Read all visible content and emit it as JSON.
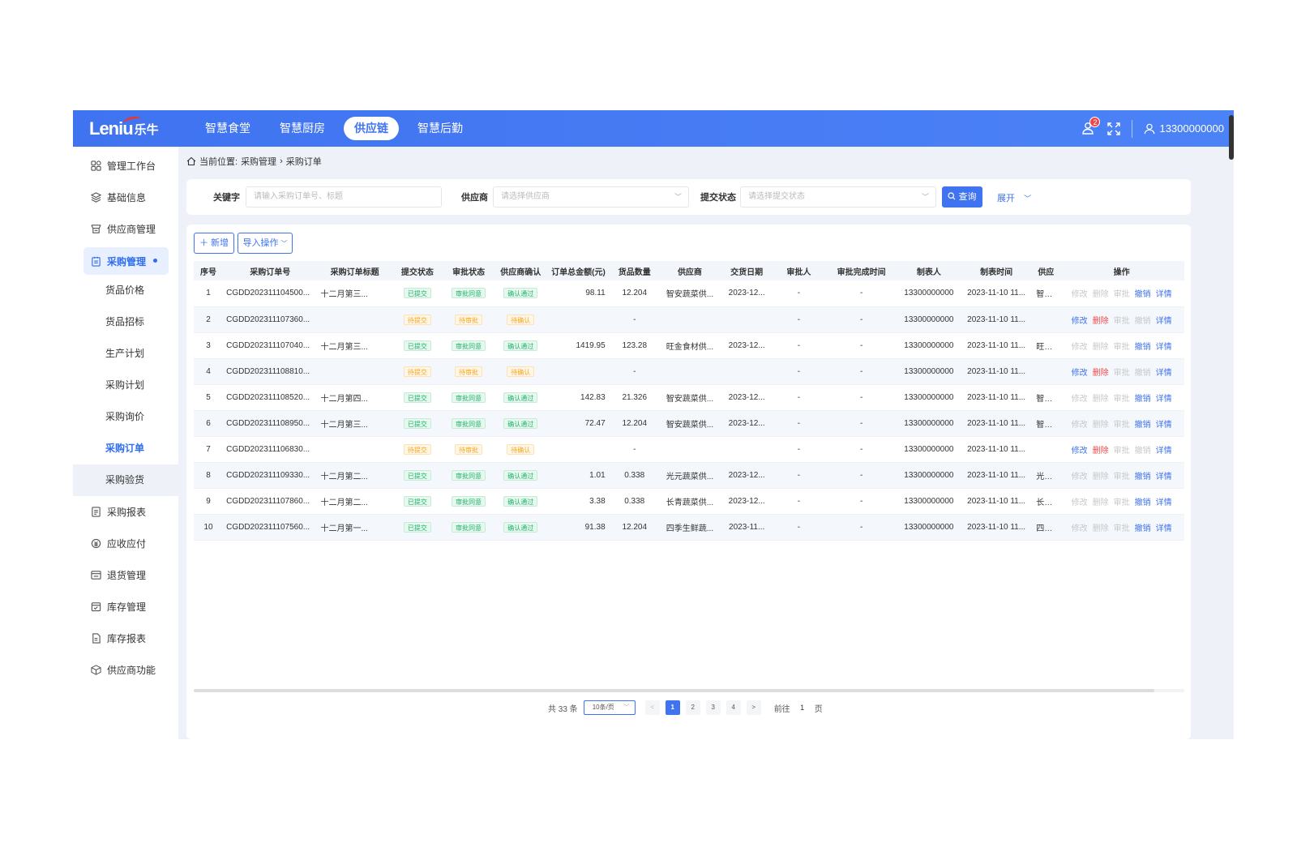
{
  "header": {
    "logo_text": "Leniu",
    "logo_cn": "乐牛",
    "nav": [
      {
        "label": "智慧食堂",
        "active": false
      },
      {
        "label": "智慧厨房",
        "active": false
      },
      {
        "label": "供应链",
        "active": true
      },
      {
        "label": "智慧后勤",
        "active": false
      }
    ],
    "notification_count": "2",
    "user_name": "13300000000"
  },
  "sidebar": {
    "items": [
      {
        "label": "管理工作台",
        "icon": "dashboard-icon"
      },
      {
        "label": "基础信息",
        "icon": "layers-icon"
      },
      {
        "label": "供应商管理",
        "icon": "supplier-icon"
      },
      {
        "label": "采购管理",
        "icon": "purchase-icon"
      },
      {
        "label": "采购报表",
        "icon": "report-icon"
      },
      {
        "label": "应收应付",
        "icon": "payment-icon"
      },
      {
        "label": "退货管理",
        "icon": "return-icon"
      },
      {
        "label": "库存管理",
        "icon": "inventory-icon"
      },
      {
        "label": "库存报表",
        "icon": "inventory-report-icon"
      },
      {
        "label": "供应商功能",
        "icon": "box-icon"
      }
    ],
    "sub_items": [
      "货品价格",
      "货品招标",
      "生产计划",
      "采购计划",
      "采购询价",
      "采购订单",
      "采购验货"
    ]
  },
  "breadcrumb": {
    "prefix": "当前位置:",
    "parent": "采购管理",
    "current": "采购订单"
  },
  "filter": {
    "keyword_label": "关键字",
    "keyword_placeholder": "请输入采购订单号、标题",
    "supplier_label": "供应商",
    "supplier_placeholder": "请选择供应商",
    "status_label": "提交状态",
    "status_placeholder": "请选择提交状态",
    "query_label": "查询",
    "expand_label": "展开"
  },
  "toolbar": {
    "add_label": "新增",
    "import_label": "导入操作"
  },
  "table": {
    "headers": [
      "序号",
      "采购订单号",
      "采购订单标题",
      "提交状态",
      "审批状态",
      "供应商确认",
      "订单总金额(元)",
      "货品数量",
      "供应商",
      "交货日期",
      "审批人",
      "审批完成时间",
      "制表人",
      "制表时间",
      "供应",
      "操作"
    ],
    "rows": [
      {
        "no": "1",
        "order_no": "CGDD202311104500...",
        "title": "十二月第三...",
        "submit": "已提交",
        "approve": "审批同意",
        "confirm": "确认通过",
        "amount": "98.11",
        "qty": "12.204",
        "supplier": "智安蔬菜供...",
        "delivery": "2023-12...",
        "approver": "-",
        "approve_time": "-",
        "maker": "13300000000",
        "make_time": "2023-11-10 11...",
        "supplier2": "智安蔬",
        "ops": [
          "修改",
          "删除",
          "审批",
          "撤销",
          "详情"
        ]
      },
      {
        "no": "2",
        "order_no": "CGDD202311107360...",
        "title": "",
        "submit": "待提交",
        "approve": "待审批",
        "confirm": "待确认",
        "amount": "",
        "qty": "-",
        "supplier": "",
        "delivery": "",
        "approver": "-",
        "approve_time": "-",
        "maker": "13300000000",
        "make_time": "2023-11-10 11...",
        "supplier2": "",
        "ops": [
          "修改",
          "删除",
          "审批",
          "撤销",
          "详情"
        ]
      },
      {
        "no": "3",
        "order_no": "CGDD202311107040...",
        "title": "十二月第三...",
        "submit": "已提交",
        "approve": "审批同意",
        "confirm": "确认通过",
        "amount": "1419.95",
        "qty": "123.28",
        "supplier": "旺金食材供...",
        "delivery": "2023-12...",
        "approver": "-",
        "approve_time": "-",
        "maker": "13300000000",
        "make_time": "2023-11-10 11...",
        "supplier2": "旺金食",
        "ops": [
          "修改",
          "删除",
          "审批",
          "撤销",
          "详情"
        ]
      },
      {
        "no": "4",
        "order_no": "CGDD202311108810...",
        "title": "",
        "submit": "待提交",
        "approve": "待审批",
        "confirm": "待确认",
        "amount": "",
        "qty": "-",
        "supplier": "",
        "delivery": "",
        "approver": "-",
        "approve_time": "-",
        "maker": "13300000000",
        "make_time": "2023-11-10 11...",
        "supplier2": "",
        "ops": [
          "修改",
          "删除",
          "审批",
          "撤销",
          "详情"
        ]
      },
      {
        "no": "5",
        "order_no": "CGDD202311108520...",
        "title": "十二月第四...",
        "submit": "已提交",
        "approve": "审批同意",
        "confirm": "确认通过",
        "amount": "142.83",
        "qty": "21.326",
        "supplier": "智安蔬菜供...",
        "delivery": "2023-12...",
        "approver": "-",
        "approve_time": "-",
        "maker": "13300000000",
        "make_time": "2023-11-10 11...",
        "supplier2": "智安蔬",
        "ops": [
          "修改",
          "删除",
          "审批",
          "撤销",
          "详情"
        ]
      },
      {
        "no": "6",
        "order_no": "CGDD202311108950...",
        "title": "十二月第三...",
        "submit": "已提交",
        "approve": "审批同意",
        "confirm": "确认通过",
        "amount": "72.47",
        "qty": "12.204",
        "supplier": "智安蔬菜供...",
        "delivery": "2023-12...",
        "approver": "-",
        "approve_time": "-",
        "maker": "13300000000",
        "make_time": "2023-11-10 11...",
        "supplier2": "智安蔬",
        "ops": [
          "修改",
          "删除",
          "审批",
          "撤销",
          "详情"
        ]
      },
      {
        "no": "7",
        "order_no": "CGDD202311106830...",
        "title": "",
        "submit": "待提交",
        "approve": "待审批",
        "confirm": "待确认",
        "amount": "",
        "qty": "-",
        "supplier": "",
        "delivery": "",
        "approver": "-",
        "approve_time": "-",
        "maker": "13300000000",
        "make_time": "2023-11-10 11...",
        "supplier2": "",
        "ops": [
          "修改",
          "删除",
          "审批",
          "撤销",
          "详情"
        ]
      },
      {
        "no": "8",
        "order_no": "CGDD202311109330...",
        "title": "十二月第二...",
        "submit": "已提交",
        "approve": "审批同意",
        "confirm": "确认通过",
        "amount": "1.01",
        "qty": "0.338",
        "supplier": "光元蔬菜供...",
        "delivery": "2023-12...",
        "approver": "-",
        "approve_time": "-",
        "maker": "13300000000",
        "make_time": "2023-11-10 11...",
        "supplier2": "光元蔬",
        "ops": [
          "修改",
          "删除",
          "审批",
          "撤销",
          "详情"
        ]
      },
      {
        "no": "9",
        "order_no": "CGDD202311107860...",
        "title": "十二月第二...",
        "submit": "已提交",
        "approve": "审批同意",
        "confirm": "确认通过",
        "amount": "3.38",
        "qty": "0.338",
        "supplier": "长青蔬菜供...",
        "delivery": "2023-12...",
        "approver": "-",
        "approve_time": "-",
        "maker": "13300000000",
        "make_time": "2023-11-10 11...",
        "supplier2": "长青蔬",
        "ops": [
          "修改",
          "删除",
          "审批",
          "撤销",
          "详情"
        ]
      },
      {
        "no": "10",
        "order_no": "CGDD202311107560...",
        "title": "十二月第一...",
        "submit": "已提交",
        "approve": "审批同意",
        "confirm": "确认通过",
        "amount": "91.38",
        "qty": "12.204",
        "supplier": "四季生鲜蔬...",
        "delivery": "2023-11...",
        "approver": "-",
        "approve_time": "-",
        "maker": "13300000000",
        "make_time": "2023-11-10 11...",
        "supplier2": "四季生",
        "ops": [
          "修改",
          "删除",
          "审批",
          "撤销",
          "详情"
        ]
      }
    ]
  },
  "pagination": {
    "total_text": "共 33 条",
    "page_size": "10条/页",
    "prev": "<",
    "pages": [
      "1",
      "2",
      "3",
      "4"
    ],
    "next": ">",
    "goto_label": "前往",
    "goto_value": "1",
    "goto_suffix": "页"
  },
  "colors": {
    "primary": "#3f73f0",
    "success": "#21b36b",
    "warning": "#f5a623",
    "danger": "#f04848"
  }
}
